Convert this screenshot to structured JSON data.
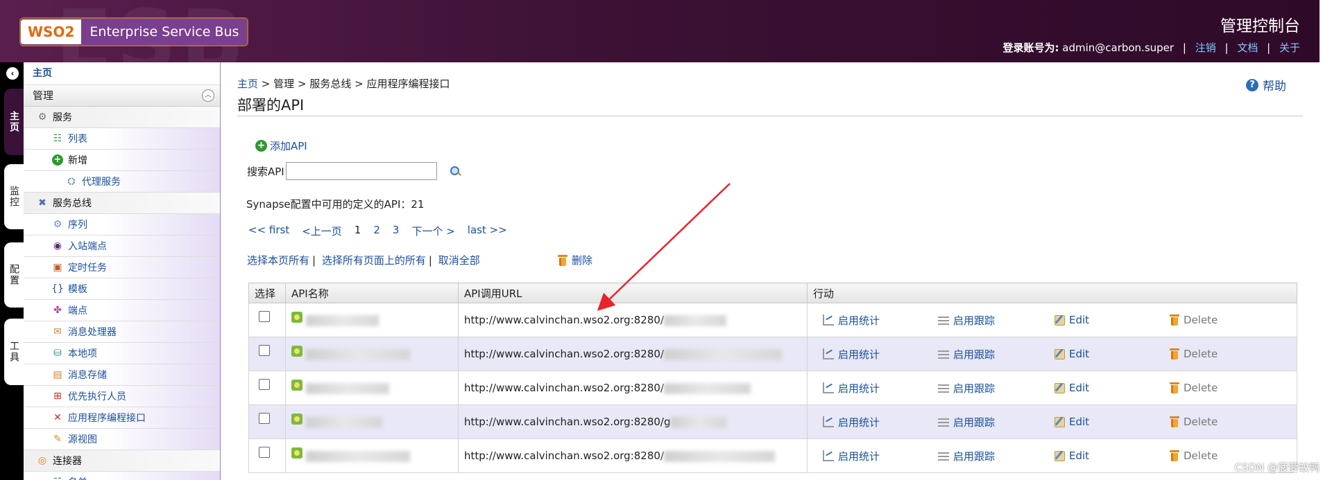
{
  "header": {
    "logo_brand": "WSO2",
    "logo_product": "Enterprise Service Bus",
    "title": "管理控制台",
    "login_label": "登录账号为:",
    "login_user": "admin@carbon.super",
    "link_logout": "注销",
    "link_docs": "文档",
    "link_about": "关于"
  },
  "vtabs": {
    "home": "主页",
    "monitor": "监控",
    "config": "配置",
    "tools": "工具"
  },
  "sidebar": {
    "home": "主页",
    "manage": "管理",
    "items": [
      {
        "label": "服务"
      },
      {
        "label": "列表"
      },
      {
        "label": "新增"
      },
      {
        "label": "代理服务"
      },
      {
        "label": "服务总线"
      },
      {
        "label": "序列"
      },
      {
        "label": "入站端点"
      },
      {
        "label": "定时任务"
      },
      {
        "label": "模板"
      },
      {
        "label": "端点"
      },
      {
        "label": "消息处理器"
      },
      {
        "label": "本地项"
      },
      {
        "label": "消息存储"
      },
      {
        "label": "优先执行人员"
      },
      {
        "label": "应用程序编程接口"
      },
      {
        "label": "源视图"
      },
      {
        "label": "连接器"
      },
      {
        "label": "名单"
      }
    ]
  },
  "main": {
    "breadcrumb": {
      "home": "主页",
      "sep": ">",
      "manage": "管理",
      "bus": "服务总线",
      "api": "应用程序编程接口"
    },
    "title": "部署的API",
    "help": "帮助",
    "add_api": "添加API",
    "search_label": "搜索API",
    "search_value": "",
    "count_text": "Synapse配置中可用的定义的API：21",
    "pager": {
      "first": "<< first",
      "prev": "<上一页",
      "p1": "1",
      "p2": "2",
      "p3": "3",
      "next": "下一个 >",
      "last": "last >>"
    },
    "select_page": "选择本页所有",
    "select_all_pages": "选择所有页面上的所有",
    "deselect": "取消全部",
    "delete": "删除",
    "table": {
      "headers": [
        "选择",
        "API名称",
        "API调用URL",
        "行动"
      ],
      "url_prefix_a": "http://www.calvinchan.wso2.org:8280/",
      "url_prefix_b": "http://www.calvinchan.wso2.org:8280/g",
      "action_stats": "启用统计",
      "action_trace": "启用跟踪",
      "action_edit": "Edit",
      "action_delete": "Delete"
    }
  },
  "watermark": "CSDN @菠萝蚊鸭",
  "colors": {
    "header_bg": "#3c1135",
    "link": "#1a4f9c",
    "row_alt": "#e8e8f7",
    "arrow": "#e8232a"
  }
}
